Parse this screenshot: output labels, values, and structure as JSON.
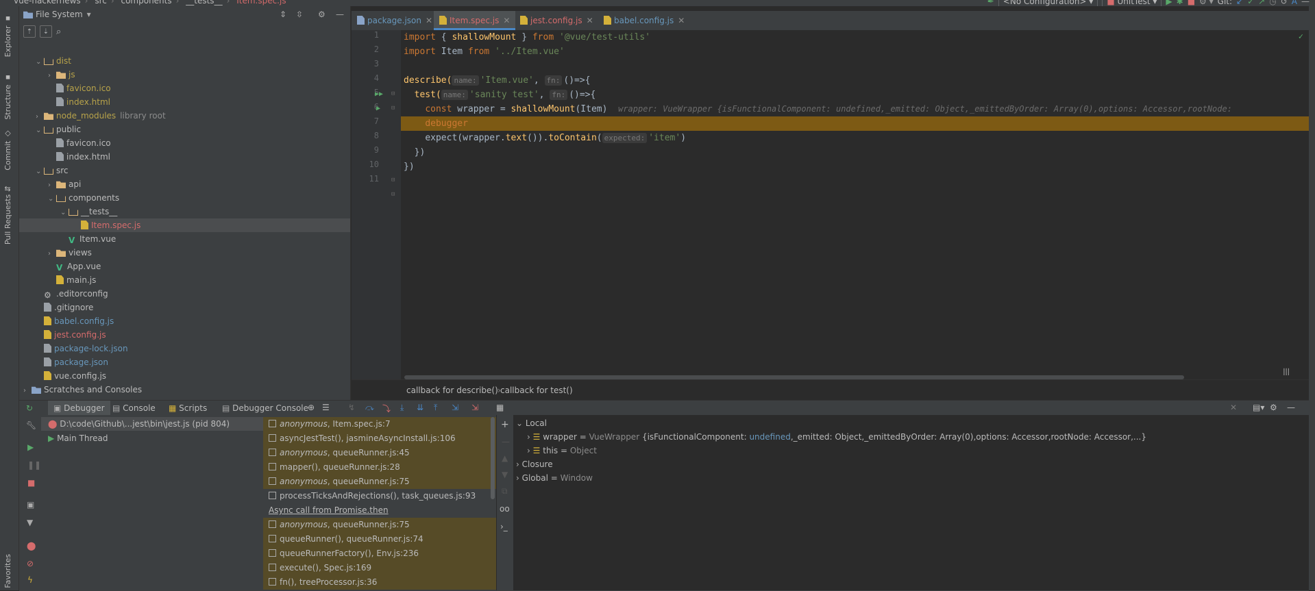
{
  "breadcrumb": [
    "vue-hackernews",
    "src",
    "components",
    "__tests__",
    "Item.spec.js"
  ],
  "run_config": "<No Configuration>",
  "unit_test_config": "UnitTest",
  "git_label": "Git:",
  "left_tabs": [
    "Explorer",
    "Structure",
    "Commit",
    "Pull Requests",
    "Favorites"
  ],
  "project": {
    "header": "File System",
    "tree": [
      {
        "label": "dist",
        "depth": 1,
        "kind": "folder",
        "expanded": true,
        "color": "yellow"
      },
      {
        "label": "js",
        "depth": 2,
        "kind": "folder",
        "expanded": false,
        "color": "yellow"
      },
      {
        "label": "favicon.ico",
        "depth": 2,
        "kind": "file",
        "color": "yellow"
      },
      {
        "label": "index.html",
        "depth": 2,
        "kind": "file",
        "color": "yellow"
      },
      {
        "label": "node_modules",
        "depth": 1,
        "kind": "folder",
        "expanded": false,
        "color": "yellow",
        "note": "library root"
      },
      {
        "label": "public",
        "depth": 1,
        "kind": "folder",
        "expanded": true,
        "color": "normal"
      },
      {
        "label": "favicon.ico",
        "depth": 2,
        "kind": "file",
        "color": "normal"
      },
      {
        "label": "index.html",
        "depth": 2,
        "kind": "file",
        "color": "normal"
      },
      {
        "label": "src",
        "depth": 1,
        "kind": "folder",
        "expanded": true,
        "color": "normal"
      },
      {
        "label": "api",
        "depth": 2,
        "kind": "folder",
        "expanded": false,
        "color": "normal"
      },
      {
        "label": "components",
        "depth": 2,
        "kind": "folder",
        "expanded": true,
        "color": "normal"
      },
      {
        "label": "__tests__",
        "depth": 3,
        "kind": "folder",
        "expanded": true,
        "color": "normal"
      },
      {
        "label": "Item.spec.js",
        "depth": 4,
        "kind": "jsfile",
        "color": "red",
        "selected": true
      },
      {
        "label": "Item.vue",
        "depth": 3,
        "kind": "vue",
        "color": "normal"
      },
      {
        "label": "views",
        "depth": 2,
        "kind": "folder",
        "expanded": false,
        "color": "normal"
      },
      {
        "label": "App.vue",
        "depth": 2,
        "kind": "vue",
        "color": "normal"
      },
      {
        "label": "main.js",
        "depth": 2,
        "kind": "jsfile",
        "color": "normal"
      },
      {
        "label": ".editorconfig",
        "depth": 1,
        "kind": "gear",
        "color": "normal"
      },
      {
        "label": ".gitignore",
        "depth": 1,
        "kind": "file",
        "color": "normal"
      },
      {
        "label": "babel.config.js",
        "depth": 1,
        "kind": "jsfile",
        "color": "blue"
      },
      {
        "label": "jest.config.js",
        "depth": 1,
        "kind": "jsfile",
        "color": "red"
      },
      {
        "label": "package-lock.json",
        "depth": 1,
        "kind": "file",
        "color": "blue"
      },
      {
        "label": "package.json",
        "depth": 1,
        "kind": "file",
        "color": "blue"
      },
      {
        "label": "vue.config.js",
        "depth": 1,
        "kind": "jsfile",
        "color": "normal"
      },
      {
        "label": "Scratches and Consoles",
        "depth": 0,
        "kind": "folder-scratch",
        "expanded": false,
        "color": "normal"
      }
    ]
  },
  "editor_tabs": [
    {
      "label": "package.json",
      "color": "blue"
    },
    {
      "label": "Item.spec.js",
      "color": "red",
      "active": true
    },
    {
      "label": "jest.config.js",
      "color": "red"
    },
    {
      "label": "babel.config.js",
      "color": "blue"
    }
  ],
  "code": {
    "line_numbers": [
      "1",
      "2",
      "3",
      "4",
      "5",
      "6",
      "7",
      "8",
      "9",
      "10",
      "11"
    ],
    "l1_kw": "import",
    "l1_a": " { ",
    "l1_fn": "shallowMount",
    "l1_b": " } ",
    "l1_from": "from",
    "l1_str": " '@vue/test-utils'",
    "l2_kw": "import",
    "l2_a": " Item ",
    "l2_from": "from",
    "l2_str": " '../Item.vue'",
    "l4_fn": "describe(",
    "l4_hint1": "name:",
    "l4_str": "'Item.vue'",
    "l4_comma": ",",
    "l4_hint2": "fn:",
    "l4_rest": "()=>{",
    "l5_fn": "test(",
    "l5_hint1": "name:",
    "l5_str": "'sanity test'",
    "l5_comma": ",",
    "l5_hint2": "fn:",
    "l5_rest": "()=>{",
    "l6_kw": "const",
    "l6_a": " wrapper = ",
    "l6_fn": "shallowMount",
    "l6_b": "(Item)",
    "l6_inline": "wrapper: VueWrapper {isFunctionalComponent: undefined,_emitted: Object,_emittedByOrder: Array(0),options: Accessor,rootNode:",
    "l7": "debugger",
    "l8_a": "expect(wrapper.",
    "l8_fn1": "text",
    "l8_b": "()).",
    "l8_fn2": "toContain",
    "l8_c": "(",
    "l8_hint": "expected:",
    "l8_str": "'item'",
    "l8_d": ")",
    "l9": "})",
    "l10": "})"
  },
  "editor_breadcrumb": [
    "callback for describe()",
    "callback for test()"
  ],
  "debug": {
    "tabs": [
      "Debugger",
      "Console",
      "Scripts",
      "Debugger Console"
    ],
    "process": "D:\\code\\Github\\...jest\\bin\\jest.js (pid 804)",
    "thread": "Main Thread",
    "frames": [
      {
        "fn": "anonymous",
        "italic": true,
        "loc": ", Item.spec.js:7",
        "style": "sel"
      },
      {
        "fn": "asyncJestTest()",
        "italic": false,
        "loc": ", jasmineAsyncInstall.js:106",
        "style": "lib"
      },
      {
        "fn": "anonymous",
        "italic": true,
        "loc": ", queueRunner.js:45",
        "style": "lib"
      },
      {
        "fn": "mapper()",
        "italic": false,
        "loc": ", queueRunner.js:28",
        "style": "lib"
      },
      {
        "fn": "anonymous",
        "italic": true,
        "loc": ", queueRunner.js:75",
        "style": "lib"
      },
      {
        "fn": "processTicksAndRejections()",
        "italic": false,
        "loc": ", task_queues.js:93",
        "style": "plain"
      },
      {
        "fn": "Async call from Promise.then",
        "italic": false,
        "loc": "",
        "style": "async"
      },
      {
        "fn": "anonymous",
        "italic": true,
        "loc": ", queueRunner.js:75",
        "style": "lib"
      },
      {
        "fn": "queueRunner()",
        "italic": false,
        "loc": ", queueRunner.js:74",
        "style": "lib"
      },
      {
        "fn": "queueRunnerFactory()",
        "italic": false,
        "loc": ", Env.js:236",
        "style": "lib"
      },
      {
        "fn": "execute()",
        "italic": false,
        "loc": ", Spec.js:169",
        "style": "lib"
      },
      {
        "fn": "fn()",
        "italic": false,
        "loc": ", treeProcessor.js:36",
        "style": "lib"
      }
    ],
    "vars": {
      "local": "Local",
      "wrapper_name": "wrapper",
      "wrapper_eq": " = ",
      "wrapper_type": "VueWrapper ",
      "wrapper_v1": "{isFunctionalComponent: ",
      "wrapper_v1v": "undefined",
      "wrapper_v2": ",_emitted: ",
      "wrapper_v2v": "Object",
      "wrapper_v3": ",_emittedByOrder: ",
      "wrapper_v3v": "Array(0)",
      "wrapper_v4": ",options: ",
      "wrapper_v4v": "Accessor",
      "wrapper_v5": ",rootNode: ",
      "wrapper_v5v": "Accessor",
      "wrapper_end": ",...}",
      "this_name": "this",
      "this_val": "Object",
      "closure": "Closure",
      "global": "Global",
      "global_val": "Window"
    }
  },
  "colors": {
    "accent": "#4a88c7",
    "exec_line": "#7d5a14",
    "keyword": "#cc7832",
    "string": "#6a8759",
    "function": "#ffc66d"
  }
}
